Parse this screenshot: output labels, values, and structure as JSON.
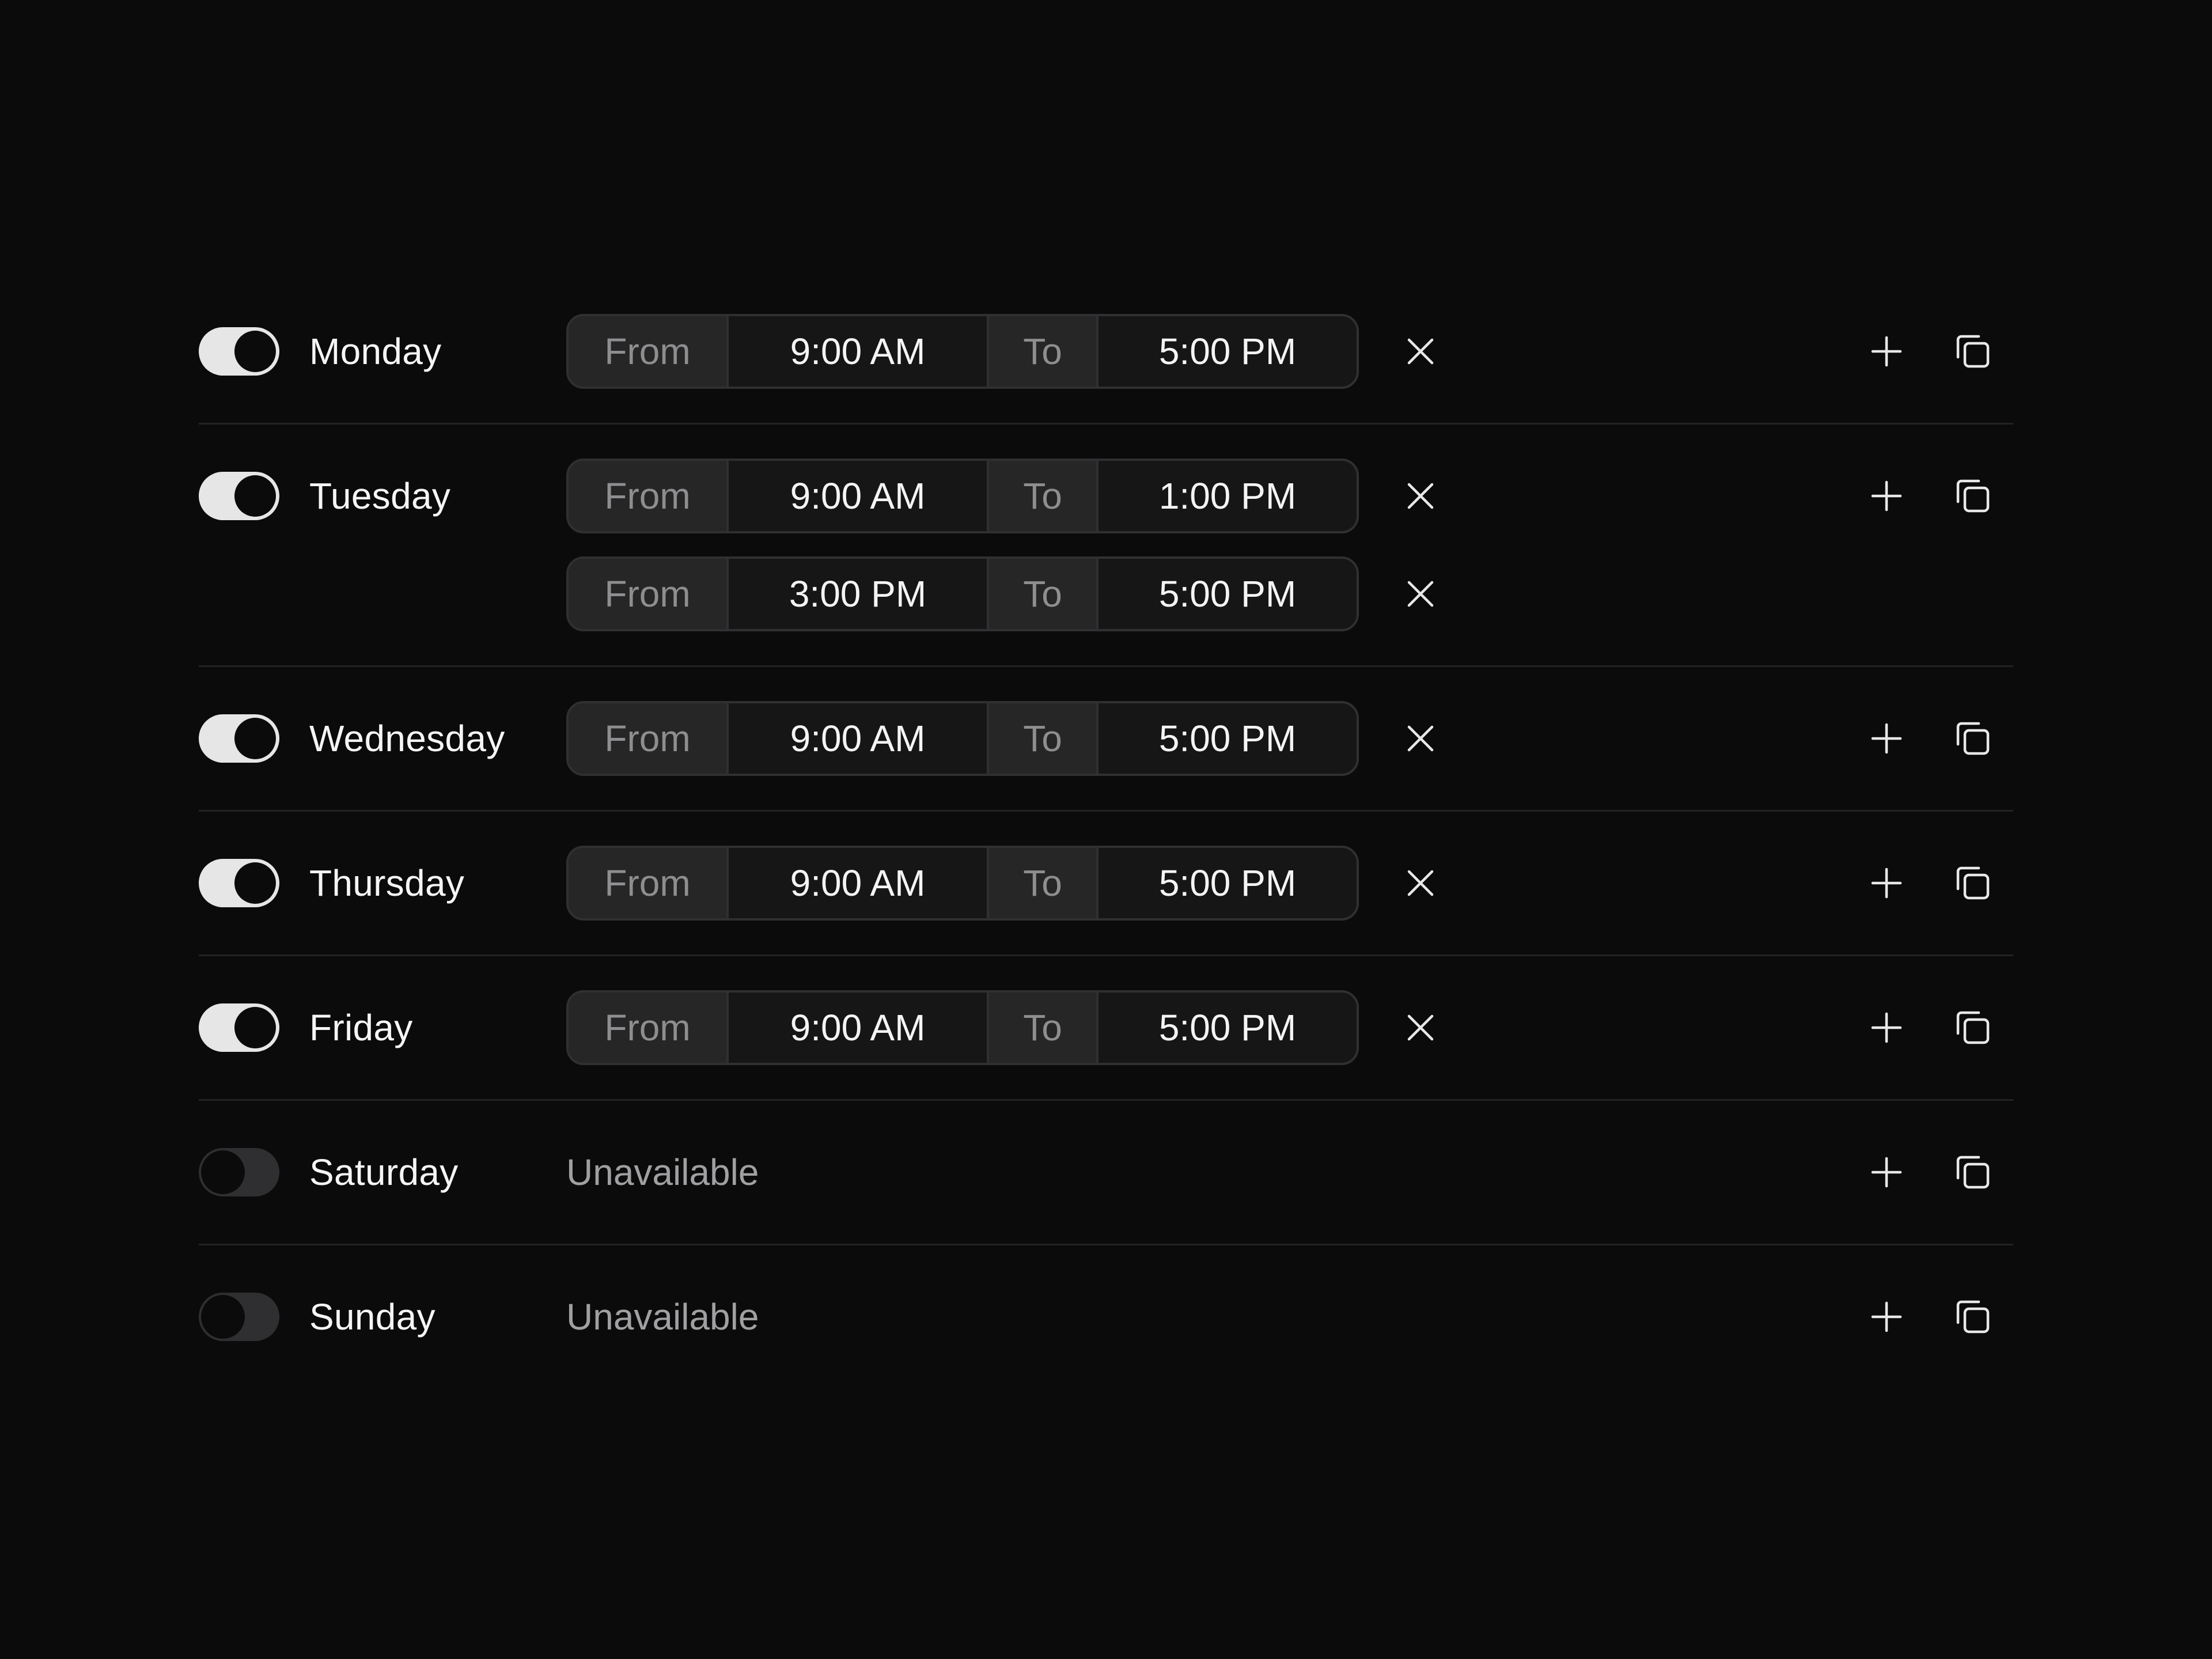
{
  "labels": {
    "from": "From",
    "to": "To",
    "unavailable": "Unavailable"
  },
  "days": [
    {
      "name": "Monday",
      "enabled": true,
      "ranges": [
        {
          "from": "9:00 AM",
          "to": "5:00 PM"
        }
      ]
    },
    {
      "name": "Tuesday",
      "enabled": true,
      "ranges": [
        {
          "from": "9:00 AM",
          "to": "1:00 PM"
        },
        {
          "from": "3:00 PM",
          "to": "5:00 PM"
        }
      ]
    },
    {
      "name": "Wednesday",
      "enabled": true,
      "ranges": [
        {
          "from": "9:00 AM",
          "to": "5:00 PM"
        }
      ]
    },
    {
      "name": "Thursday",
      "enabled": true,
      "ranges": [
        {
          "from": "9:00 AM",
          "to": "5:00 PM"
        }
      ]
    },
    {
      "name": "Friday",
      "enabled": true,
      "ranges": [
        {
          "from": "9:00 AM",
          "to": "5:00 PM"
        }
      ]
    },
    {
      "name": "Saturday",
      "enabled": false,
      "ranges": []
    },
    {
      "name": "Sunday",
      "enabled": false,
      "ranges": []
    }
  ],
  "icons": {
    "remove": "close-icon",
    "add": "plus-icon",
    "copy": "copy-icon"
  },
  "colors": {
    "background": "#0b0b0c",
    "toggle_on": "#e6e6e6",
    "toggle_off": "#2f2f31",
    "divider": "#232325",
    "muted_text": "#8e8e90"
  }
}
